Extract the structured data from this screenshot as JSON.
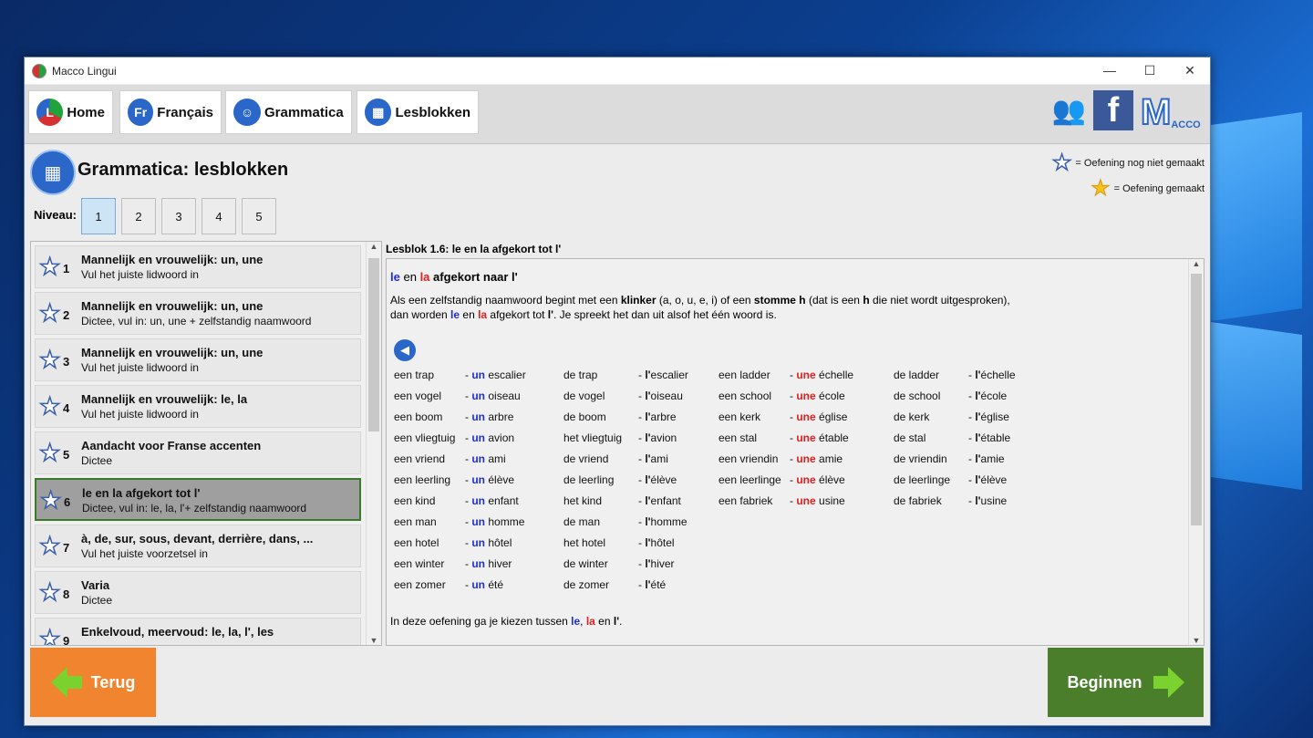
{
  "window": {
    "title": "Macco Lingui",
    "controls": [
      "—",
      "☐",
      "✕"
    ]
  },
  "toolbar": {
    "buttons": [
      {
        "label": "Home",
        "icon": "home-logo-icon"
      },
      {
        "label": "Français",
        "icon": "french-flag-icon",
        "icon_text": "Fr"
      },
      {
        "label": "Grammatica",
        "icon": "grammar-head-icon"
      },
      {
        "label": "Lesblokken",
        "icon": "lesson-blocks-icon"
      }
    ],
    "right_icons": [
      "users-icon",
      "facebook-icon",
      "macco-logo-icon"
    ],
    "macco_text": "ACCO"
  },
  "page": {
    "title": "Grammatica: lesblokken"
  },
  "legend": {
    "not_done": "= Oefening nog niet gemaakt",
    "done": "= Oefening gemaakt"
  },
  "levels": {
    "label": "Niveau:",
    "items": [
      "1",
      "2",
      "3",
      "4",
      "5"
    ],
    "selected": "1"
  },
  "lessons": [
    {
      "num": "1",
      "title": "Mannelijk en vrouwelijk: un, une",
      "sub": "Vul het juiste lidwoord in"
    },
    {
      "num": "2",
      "title": "Mannelijk en vrouwelijk: un, une",
      "sub": "Dictee, vul in: un, une + zelfstandig naamwoord"
    },
    {
      "num": "3",
      "title": "Mannelijk en vrouwelijk: un, une",
      "sub": "Vul het juiste lidwoord in"
    },
    {
      "num": "4",
      "title": "Mannelijk en vrouwelijk: le, la",
      "sub": "Vul het juiste lidwoord in"
    },
    {
      "num": "5",
      "title": "Aandacht voor Franse accenten",
      "sub": "Dictee"
    },
    {
      "num": "6",
      "title": "le en la afgekort tot l'",
      "sub": "Dictee, vul in: le, la, l'+ zelfstandig naamwoord",
      "selected": true
    },
    {
      "num": "7",
      "title": "à, de, sur, sous, devant, derrière, dans, ...",
      "sub": "Vul het juiste voorzetsel in"
    },
    {
      "num": "8",
      "title": "Varia",
      "sub": "Dictee"
    },
    {
      "num": "9",
      "title": "Enkelvoud, meervoud: le, la, l', les",
      "sub": ""
    }
  ],
  "lesson": {
    "title": "Lesblok 1.6: le en la afgekort tot l'",
    "heading": {
      "le": "le",
      "en": "en",
      "la": "la",
      "rest": "afgekort naar l'"
    },
    "para1": {
      "a": "Als een zelfstandig naamwoord begint met een ",
      "b": "klinker",
      "c": " (a, o, u, e, i) of een ",
      "d": "stomme h",
      "e": " (dat is een ",
      "f": "h",
      "g": " die niet wordt uitgesproken),"
    },
    "para2": {
      "a": "dan worden ",
      "le": "le",
      "b": " en ",
      "la": "la",
      "c": " afgekort tot ",
      "l": "l'",
      "d": ". Je spreekt het dan uit alsof het één woord is."
    },
    "footer": {
      "a": "In deze oefening ga je kiezen tussen ",
      "le": "le",
      "sep": ", ",
      "la": "la",
      "b": " en ",
      "l": "l'",
      "c": "."
    },
    "vocab_col1": [
      [
        "een trap",
        "un",
        "escalier",
        "de trap",
        "l'",
        "escalier"
      ],
      [
        "een vogel",
        "un",
        "oiseau",
        "de vogel",
        "l'",
        "oiseau"
      ],
      [
        "een boom",
        "un",
        "arbre",
        "de boom",
        "l'",
        "arbre"
      ],
      [
        "een vliegtuig",
        "un",
        "avion",
        "het vliegtuig",
        "l'",
        "avion"
      ],
      [
        "een vriend",
        "un",
        "ami",
        "de vriend",
        "l'",
        "ami"
      ],
      [
        "een leerling",
        "un",
        "élève",
        "de leerling",
        "l'",
        "élève"
      ],
      [
        "een kind",
        "un",
        "enfant",
        "het kind",
        "l'",
        "enfant"
      ],
      [
        "een man",
        "un",
        "homme",
        "de man",
        "l'",
        "homme"
      ],
      [
        "een hotel",
        "un",
        "hôtel",
        "het hotel",
        "l'",
        "hôtel"
      ],
      [
        "een winter",
        "un",
        "hiver",
        "de winter",
        "l'",
        "hiver"
      ],
      [
        "een zomer",
        "un",
        "été",
        "de zomer",
        "l'",
        "été"
      ]
    ],
    "vocab_col2": [
      [
        "een ladder",
        "une",
        "échelle",
        "de ladder",
        "l'",
        "échelle"
      ],
      [
        "een school",
        "une",
        "école",
        "de school",
        "l'",
        "école"
      ],
      [
        "een kerk",
        "une",
        "église",
        "de kerk",
        "l'",
        "église"
      ],
      [
        "een stal",
        "une",
        "étable",
        "de stal",
        "l'",
        "étable"
      ],
      [
        "een vriendin",
        "une",
        "amie",
        "de vriendin",
        "l'",
        "amie"
      ],
      [
        "een leerlinge",
        "une",
        "élève",
        "de leerlinge",
        "l'",
        "élève"
      ],
      [
        "een fabriek",
        "une",
        "usine",
        "de fabriek",
        "l'",
        "usine"
      ]
    ]
  },
  "buttons": {
    "back": "Terug",
    "start": "Beginnen"
  },
  "colors": {
    "masc": "#1e2fd6",
    "fem": "#e02020",
    "back_bg": "#f0842f",
    "start_bg": "#4a7e2a",
    "arrow": "#7bd12e"
  }
}
